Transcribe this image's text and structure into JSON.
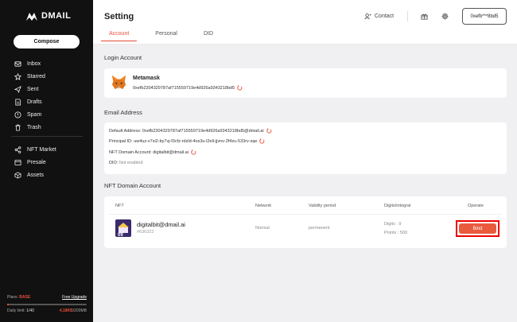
{
  "brand": {
    "name": "DMAIL"
  },
  "sidebar": {
    "compose_label": "Compose",
    "mail_items": [
      {
        "label": "Inbox",
        "icon": "inbox-icon"
      },
      {
        "label": "Starred",
        "icon": "star-icon"
      },
      {
        "label": "Sent",
        "icon": "send-icon"
      },
      {
        "label": "Drafts",
        "icon": "drafts-icon"
      },
      {
        "label": "Spam",
        "icon": "spam-icon"
      },
      {
        "label": "Trash",
        "icon": "trash-icon"
      }
    ],
    "web3_items": [
      {
        "label": "NFT Market",
        "icon": "share-icon"
      },
      {
        "label": "Presale",
        "icon": "presale-icon"
      },
      {
        "label": "Assets",
        "icon": "assets-icon"
      }
    ],
    "plans": {
      "label": "Plans:",
      "plan_name": "BASE",
      "upgrade_label": "Free Upgrade",
      "daily_limit_label": "Daily limit:",
      "daily_limit_value": "1/40",
      "storage_used": "4.18KB",
      "storage_total": "/200MB",
      "usage_fraction": 0.02
    }
  },
  "header": {
    "title": "Setting",
    "contact_label": "Contact",
    "account_short": "0xefb***8bd5",
    "tabs": [
      "Account",
      "Personal",
      "DID"
    ],
    "active_tab": "Account"
  },
  "login_account": {
    "section_title": "Login Account",
    "wallet_name": "Metamask",
    "address": "0xefb2304329787af715559719e4d926a9343218bd5"
  },
  "email_address": {
    "section_title": "Email Address",
    "default_label": "Default Address:",
    "default_value": "0xefb2304329787af715559719e4d926a9343218bd5@dmail.ai",
    "principal_label": "Principal ID:",
    "principal_value": "uw4uz-v7si2-by7vj-f3cfz-rdzld-4os3u-l2eli-jjvnv-2f4zu-533rv-sqe",
    "nft_label": "NFT Domain Account:",
    "nft_value": "digitalbit@dmail.ai",
    "dio_label": "DIO:",
    "dio_value": "Not enabled"
  },
  "nft_domain": {
    "section_title": "NFT Domain Account",
    "columns": [
      "NFT",
      "Network",
      "Validity period",
      "Digits/integral",
      "Operate"
    ],
    "row": {
      "name": "digitalbit@dmail.ai",
      "id": "#636322",
      "avatar_badge": "09",
      "network": "Normal",
      "validity": "permanent",
      "digits": "Digits : 9",
      "points": "Points : 500",
      "action_label": "Bind"
    }
  },
  "colors": {
    "accent": "#e84d38",
    "sidebar_bg": "#111111",
    "highlight_box": "#e00000"
  }
}
